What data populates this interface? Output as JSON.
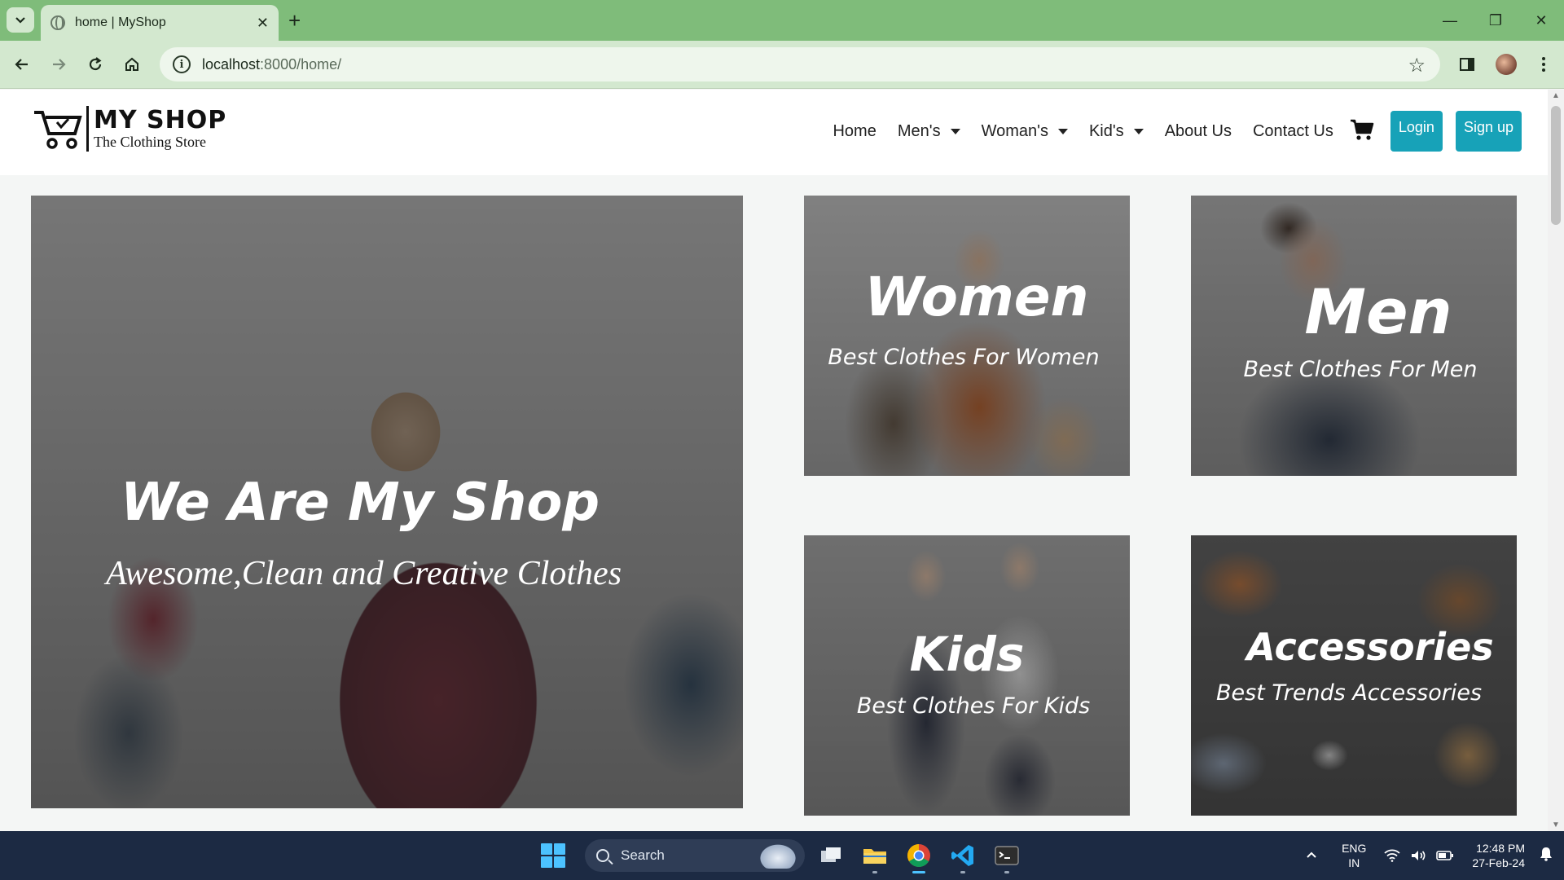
{
  "browser": {
    "tab_title": "home | MyShop",
    "url_host": "localhost",
    "url_rest": ":8000/home/"
  },
  "site": {
    "brand_name": "MY SHOP",
    "brand_tagline": "The Clothing Store",
    "nav": {
      "home": "Home",
      "mens": "Men's",
      "womans": "Woman's",
      "kids": "Kid's",
      "about": "About Us",
      "contact": "Contact Us"
    },
    "login": "Login",
    "signup": "Sign up"
  },
  "hero": {
    "title": "We Are My Shop",
    "subtitle": "Awesome,Clean and Creative Clothes"
  },
  "cards": {
    "women": {
      "title": "Women",
      "subtitle": "Best Clothes For Women"
    },
    "men": {
      "title": "Men",
      "subtitle": "Best Clothes For Men"
    },
    "kids": {
      "title": "Kids",
      "subtitle": "Best Clothes For Kids"
    },
    "accessories": {
      "title": "Accessories",
      "subtitle": "Best Trends Accessories"
    }
  },
  "taskbar": {
    "search_label": "Search",
    "lang_line1": "ENG",
    "lang_line2": "IN",
    "time": "12:48 PM",
    "date": "27-Feb-24"
  },
  "colors": {
    "chrome_tabbar": "#7fbc7a",
    "chrome_toolbar": "#d3e8cf",
    "button_primary": "#17a2b8",
    "taskbar": "#1c2a43"
  }
}
